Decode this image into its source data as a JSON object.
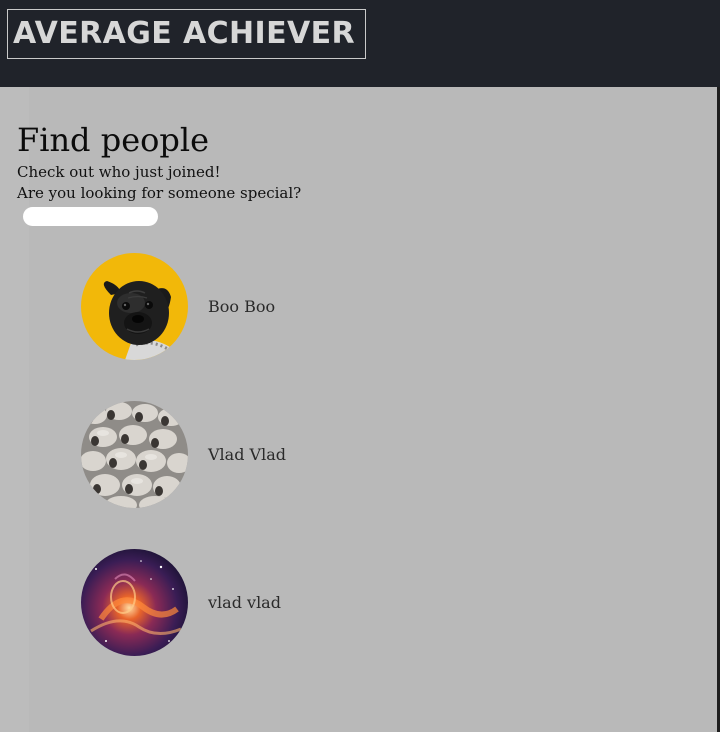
{
  "header": {
    "logo": "AVERAGE ACHIEVER"
  },
  "main": {
    "title": "Find people",
    "subtitle_1": "Check out who just joined!",
    "subtitle_2": "Are you looking for someone special?"
  },
  "search": {
    "placeholder": ""
  },
  "people": [
    {
      "name": "Boo Boo",
      "avatar": "pug-dog-on-yellow"
    },
    {
      "name": "Vlad Vlad",
      "avatar": "flock-of-sheep"
    },
    {
      "name": "vlad vlad",
      "avatar": "galaxy-nebula"
    }
  ],
  "colors": {
    "header_bg": "#20232a",
    "page_bg": "#b9b9b9",
    "logo_text": "#d7d7d7",
    "avatar_yellow": "#f2b809"
  }
}
